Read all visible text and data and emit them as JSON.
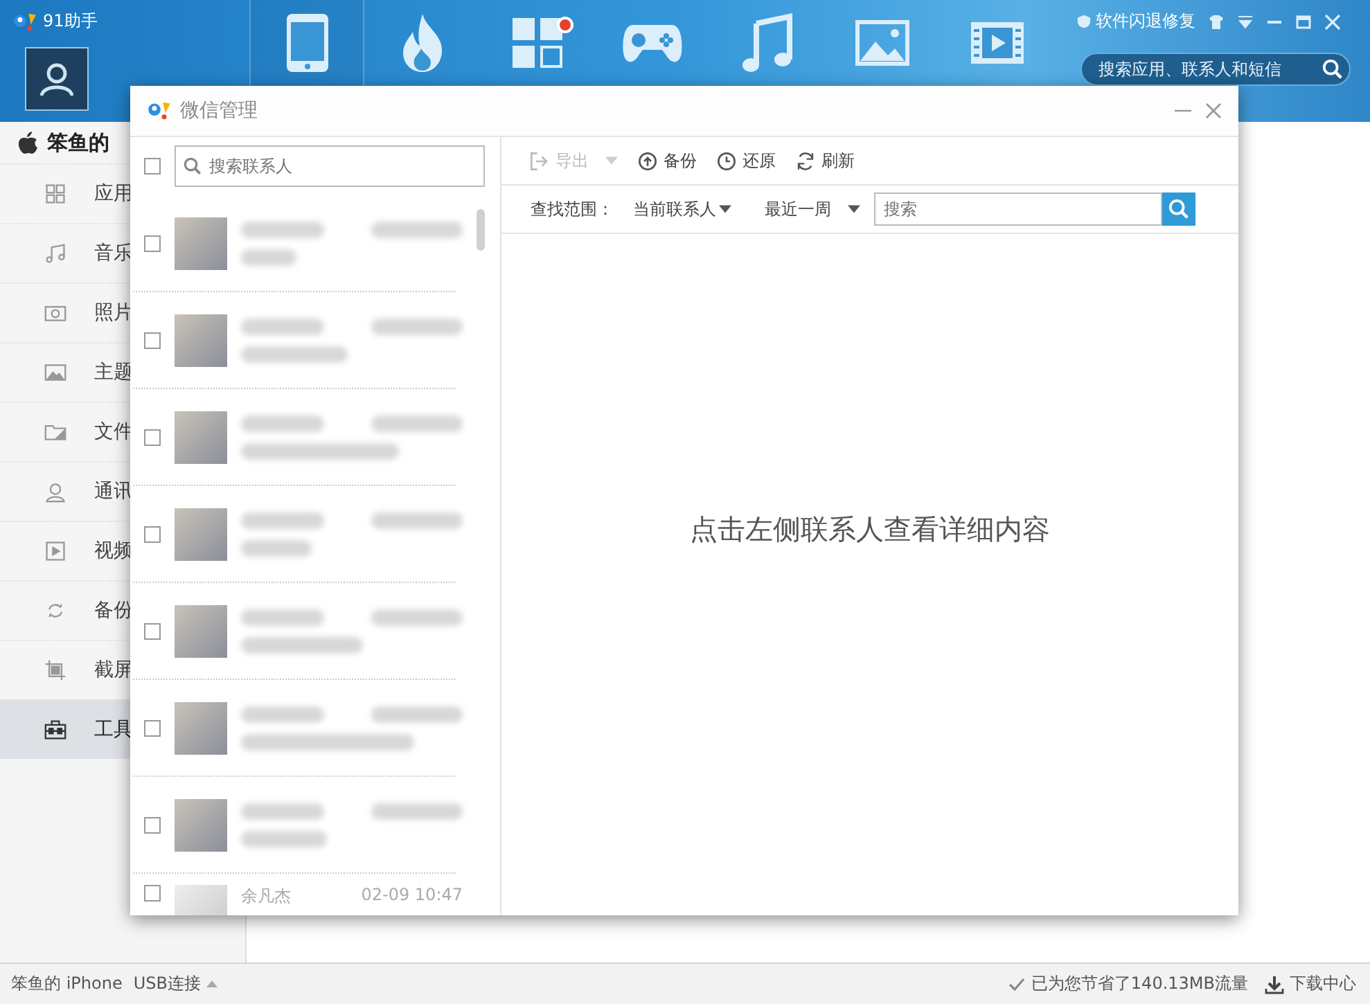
{
  "app": {
    "title": "91助手"
  },
  "nav": [
    {
      "kind": "phone",
      "badge": false,
      "selected": true
    },
    {
      "kind": "fire",
      "badge": false,
      "selected": false
    },
    {
      "kind": "apps",
      "badge": true,
      "selected": false
    },
    {
      "kind": "gamepad",
      "badge": false,
      "selected": false
    },
    {
      "kind": "music",
      "badge": false,
      "selected": false
    },
    {
      "kind": "picture",
      "badge": false,
      "selected": false
    },
    {
      "kind": "film",
      "badge": false,
      "selected": false
    }
  ],
  "header_right": {
    "repair_link": "软件闪退修复",
    "search": {
      "placeholder": "搜索应用、联系人和短信"
    }
  },
  "sidebar": {
    "device": "笨鱼的",
    "items": [
      {
        "kind": "apps",
        "label": "应用",
        "selected": false
      },
      {
        "kind": "music",
        "label": "音乐",
        "selected": false
      },
      {
        "kind": "photo",
        "label": "照片",
        "selected": false
      },
      {
        "kind": "theme",
        "label": "主题",
        "selected": false
      },
      {
        "kind": "folder",
        "label": "文件",
        "selected": false
      },
      {
        "kind": "contact",
        "label": "通讯",
        "selected": false
      },
      {
        "kind": "video",
        "label": "视频",
        "selected": false
      },
      {
        "kind": "backup",
        "label": "备份",
        "selected": false
      },
      {
        "kind": "screenshot",
        "label": "截屏",
        "selected": false
      },
      {
        "kind": "toolbox",
        "label": "工具",
        "selected": true
      }
    ]
  },
  "dialog": {
    "title": "微信管理",
    "select_all": {
      "checked": false
    },
    "contact_search": {
      "placeholder": "搜索联系人"
    },
    "contacts": [
      {
        "kind": "blurred",
        "checked": false
      },
      {
        "kind": "blurred",
        "checked": false
      },
      {
        "kind": "blurred",
        "checked": false
      },
      {
        "kind": "blurred",
        "checked": false
      },
      {
        "kind": "blurred",
        "checked": false
      },
      {
        "kind": "blurred",
        "checked": false
      },
      {
        "kind": "blurred",
        "checked": false
      },
      {
        "kind": "plain",
        "checked": false,
        "name": "余凡杰",
        "time": "02-09 10:47"
      }
    ],
    "toolbar": [
      {
        "kind": "export",
        "label": "导出",
        "disabled": true,
        "dropdown": true
      },
      {
        "kind": "backup",
        "label": "备份",
        "disabled": false,
        "dropdown": false
      },
      {
        "kind": "restore",
        "label": "还原",
        "disabled": false,
        "dropdown": false
      },
      {
        "kind": "refresh",
        "label": "刷新",
        "disabled": false,
        "dropdown": false
      }
    ],
    "filter": {
      "label": "查找范围：",
      "scope": "当前联系人",
      "period": "最近一周",
      "search": {
        "placeholder": "搜索"
      }
    },
    "empty_message": "点击左侧联系人查看详细内容"
  },
  "status_bar": {
    "device": "笨鱼的 iPhone",
    "connection": "USB连接",
    "saved": "已为您节省了140.13MB流量",
    "downloads": "下载中心"
  }
}
